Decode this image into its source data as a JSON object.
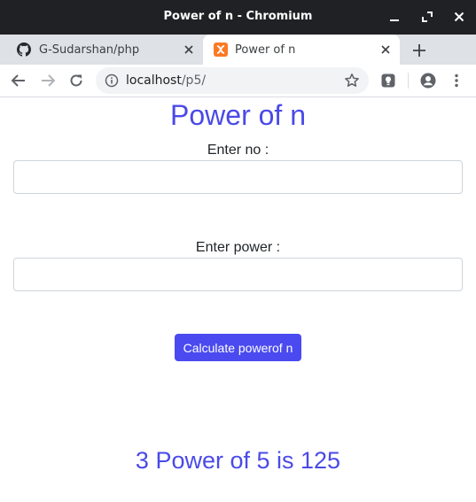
{
  "window": {
    "title": "Power of n - Chromium"
  },
  "tabs": [
    {
      "label": "G-Sudarshan/php",
      "icon": "github-icon",
      "active": false
    },
    {
      "label": "Power of n",
      "icon": "xampp-icon",
      "active": true
    }
  ],
  "address_bar": {
    "host": "localhost",
    "path": "/p5/"
  },
  "page": {
    "heading": "Power of n",
    "number_label": "Enter no :",
    "number_value": "",
    "power_label": "Enter power :",
    "power_value": "",
    "button_label": "Calculate powerof n",
    "result": "3 Power of 5 is 125"
  },
  "colors": {
    "accent": "#4a4ae8",
    "button": "#4a4af0",
    "titlebar": "#202124",
    "tabstrip": "#dee1e6",
    "xampp_orange": "#fb7a24"
  }
}
